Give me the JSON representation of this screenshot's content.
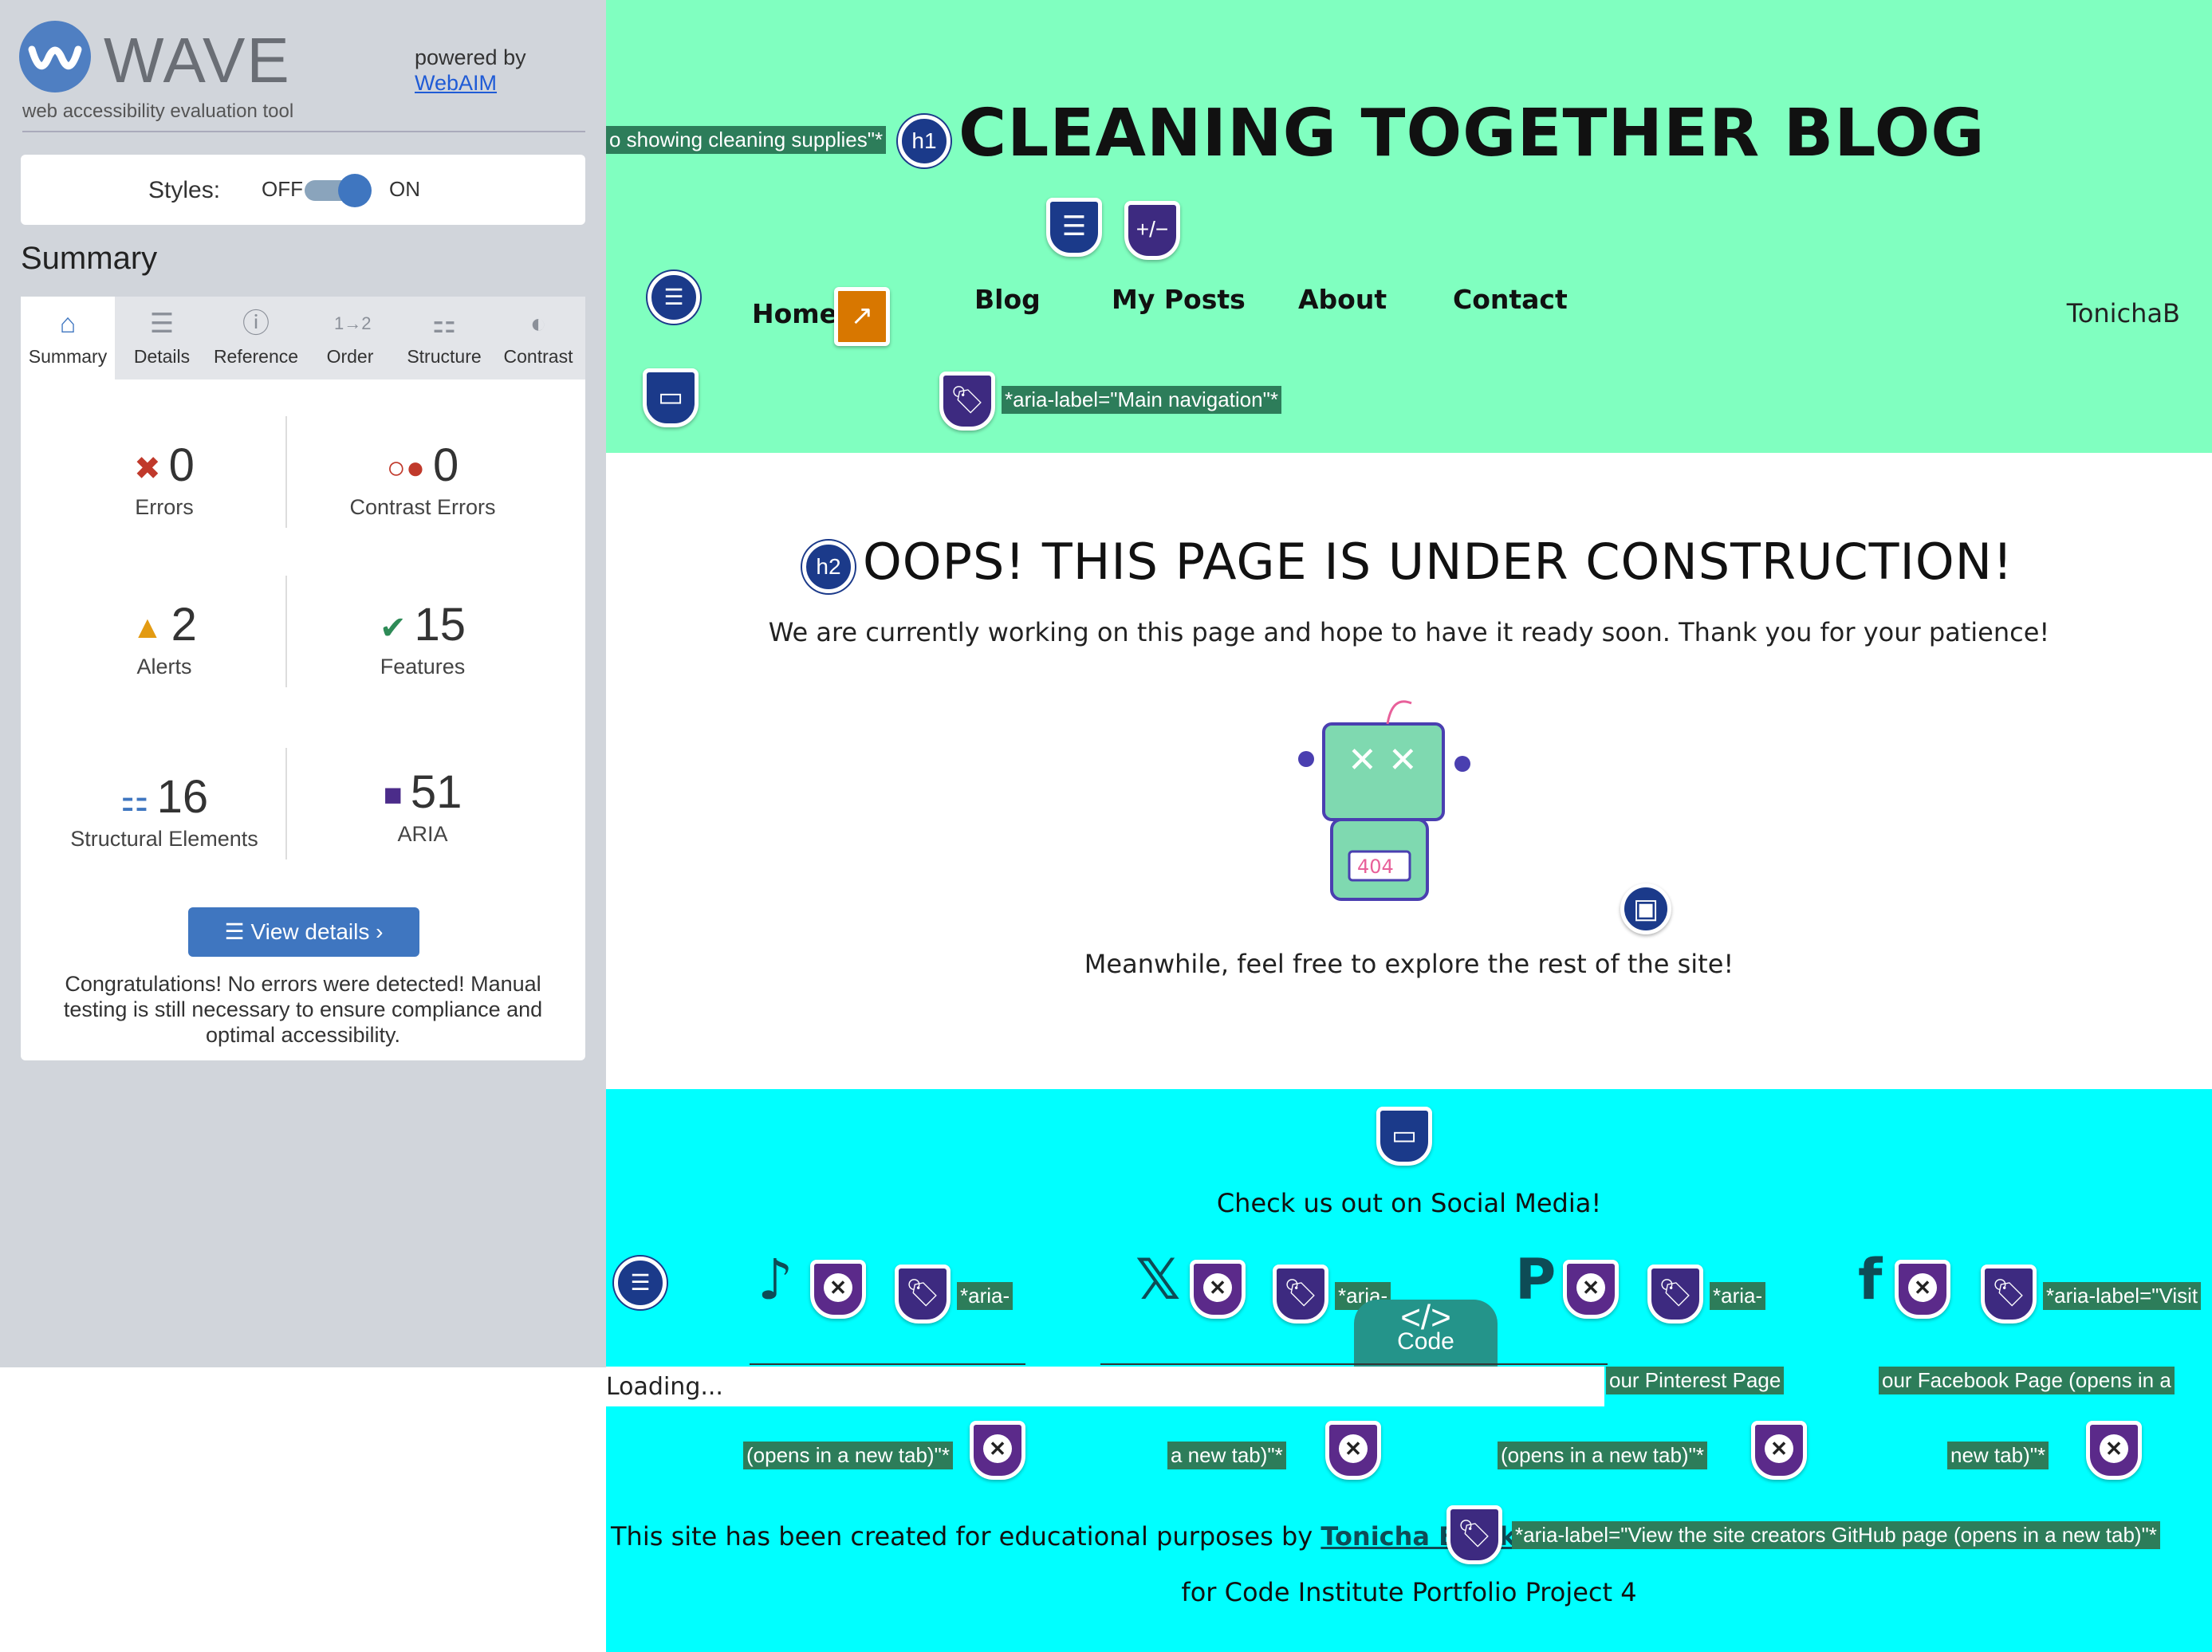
{
  "wave": {
    "logo": "WAVE",
    "tagline": "web accessibility evaluation tool",
    "powered_by": "powered by",
    "webaim": "WebAIM",
    "styles_label": "Styles:",
    "off": "OFF",
    "on": "ON",
    "summary_title": "Summary",
    "tabs": [
      {
        "label": "Summary",
        "icon": "home-icon"
      },
      {
        "label": "Details",
        "icon": "list-icon"
      },
      {
        "label": "Reference",
        "icon": "info-icon"
      },
      {
        "label": "Order",
        "icon": "order-icon"
      },
      {
        "label": "Structure",
        "icon": "structure-icon"
      },
      {
        "label": "Contrast",
        "icon": "contrast-icon"
      }
    ],
    "stats": {
      "errors": {
        "value": "0",
        "label": "Errors"
      },
      "contrast_errors": {
        "value": "0",
        "label": "Contrast Errors"
      },
      "alerts": {
        "value": "2",
        "label": "Alerts"
      },
      "features": {
        "value": "15",
        "label": "Features"
      },
      "structural": {
        "value": "16",
        "label": "Structural Elements"
      },
      "aria": {
        "value": "51",
        "label": "ARIA"
      }
    },
    "view_details": "View details ›",
    "congrats": "Congratulations! No errors were detected! Manual testing is still necessary to ensure compliance and optimal accessibility."
  },
  "site": {
    "alt_label": "o showing cleaning supplies\"*",
    "h1_badge": "h1",
    "h1": "CLEANING TOGETHER BLOG",
    "nav": [
      "Home",
      "Blog",
      "My Posts",
      "About",
      "Contact"
    ],
    "user": "TonichaB",
    "nav_aria": "*aria-label=\"Main navigation\"*",
    "h2_badge": "h2",
    "h2": "OOPS! THIS PAGE IS UNDER CONSTRUCTION!",
    "p1": "We are currently working on this page and hope to have it ready soon. Thank you for your patience!",
    "robot_code": "404",
    "p2": "Meanwhile, feel free to explore the rest of the site!",
    "social_title": "Check us out on Social Media!",
    "aria_short": "*aria-",
    "aria_fb": "*aria-label=\"Visit",
    "pinterest_page": "our Pinterest Page",
    "facebook_page": "our Facebook Page (opens in a",
    "opens_tab_1": "(opens in a new tab)\"*",
    "opens_tab_2": "a new tab)\"*",
    "opens_tab_3": "(opens in a new tab)\"*",
    "opens_tab_4": "new tab)\"*",
    "credit_prefix": "This site has been created for educational purposes by",
    "credit_name": "Tonicha Blackwell",
    "credit_aria": "*aria-label=\"View the site creators GitHub page (opens in a new tab)\"*",
    "credit_suffix": "for Code Institute Portfolio Project 4",
    "code_tab": "Code",
    "loading": "Loading..."
  }
}
